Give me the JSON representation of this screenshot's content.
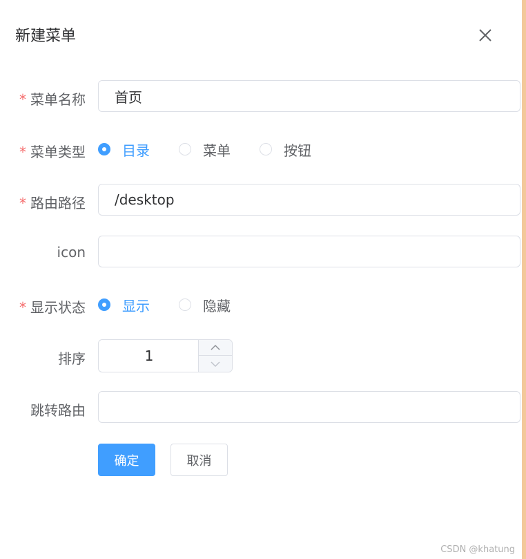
{
  "dialog": {
    "title": "新建菜单"
  },
  "form": {
    "menu_name": {
      "label": "菜单名称",
      "required": "*",
      "value": "首页"
    },
    "menu_type": {
      "label": "菜单类型",
      "required": "*",
      "options": [
        {
          "label": "目录",
          "checked": true
        },
        {
          "label": "菜单",
          "checked": false
        },
        {
          "label": "按钮",
          "checked": false
        }
      ]
    },
    "route_path": {
      "label": "路由路径",
      "required": "*",
      "value": "/desktop"
    },
    "icon": {
      "label": "icon",
      "value": ""
    },
    "display_state": {
      "label": "显示状态",
      "required": "*",
      "options": [
        {
          "label": "显示",
          "checked": true
        },
        {
          "label": "隐藏",
          "checked": false
        }
      ]
    },
    "sort": {
      "label": "排序",
      "value": "1"
    },
    "redirect": {
      "label": "跳转路由",
      "value": ""
    }
  },
  "actions": {
    "confirm": "确定",
    "cancel": "取消"
  },
  "watermark": "CSDN @khatung",
  "colors": {
    "primary": "#409eff",
    "required": "#f56c6c",
    "border": "#dcdfe6",
    "accent_stripe": "#f3c89a"
  },
  "icons": {
    "close": "close-icon",
    "increase": "chevron-up-icon",
    "decrease": "chevron-down-icon"
  }
}
